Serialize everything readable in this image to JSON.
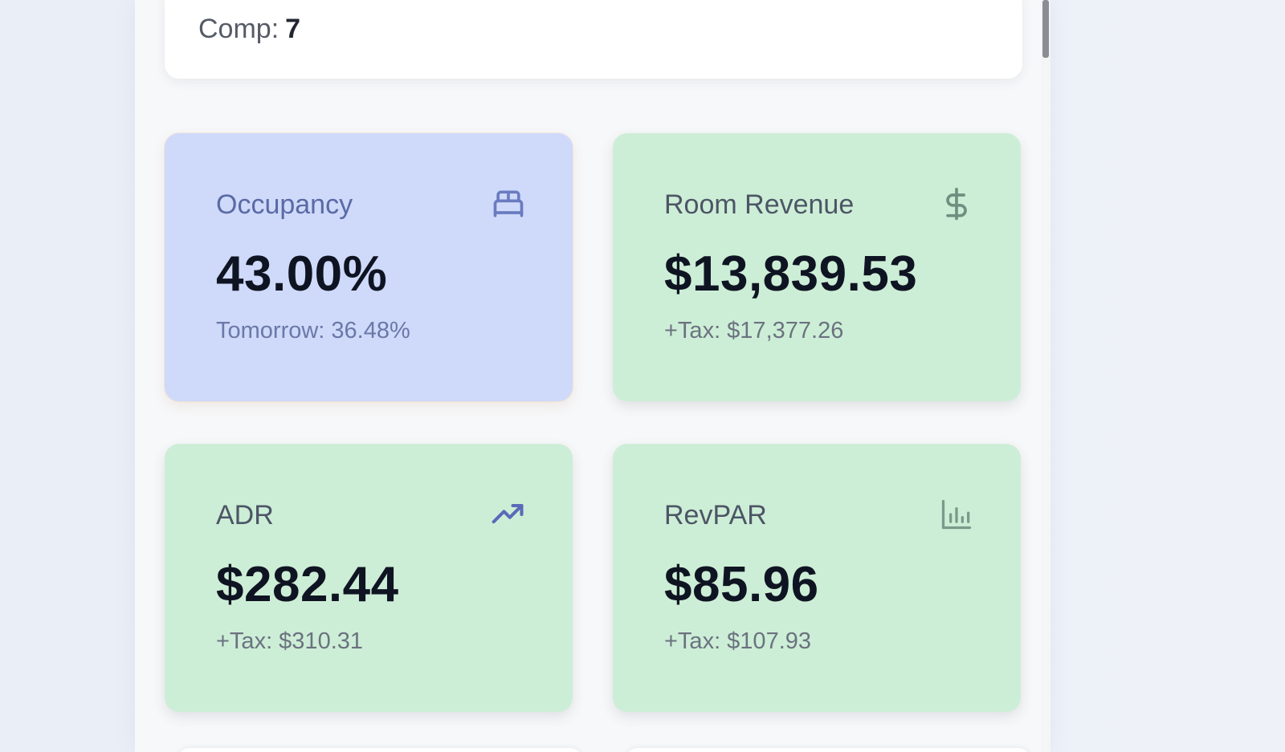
{
  "summary": {
    "comp_label": "Comp:",
    "comp_value": "7"
  },
  "metrics": [
    {
      "label": "Occupancy",
      "value": "43.00%",
      "sub": "Tomorrow: 36.48%",
      "icon": "bed-icon",
      "color": "#cfdafa"
    },
    {
      "label": "Room Revenue",
      "value": "$13,839.53",
      "sub": "+Tax: $17,377.26",
      "icon": "dollar-icon",
      "color": "#cdeed6"
    },
    {
      "label": "ADR",
      "value": "$282.44",
      "sub": "+Tax: $310.31",
      "icon": "trending-up-icon",
      "color": "#cdeed6"
    },
    {
      "label": "RevPAR",
      "value": "$85.96",
      "sub": "+Tax: $107.93",
      "icon": "bar-chart-icon",
      "color": "#cdeed6"
    }
  ]
}
